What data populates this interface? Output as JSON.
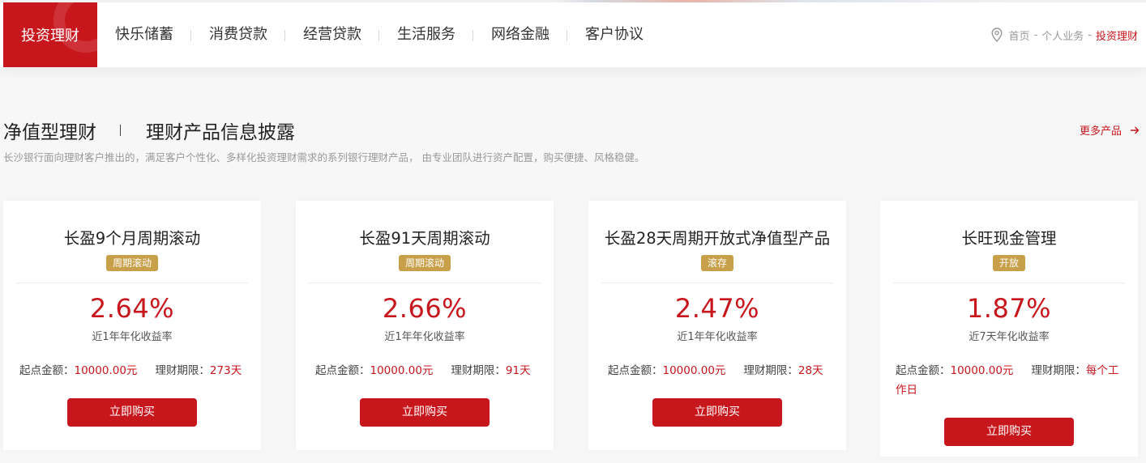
{
  "nav": {
    "active": "投资理财",
    "items": [
      "快乐储蓄",
      "消费贷款",
      "经营贷款",
      "生活服务",
      "网络金融",
      "客户协议"
    ]
  },
  "breadcrumb": {
    "home": "首页",
    "sep": "-",
    "level2": "个人业务",
    "current": "投资理财"
  },
  "section": {
    "title1": "净值型理财",
    "title2": "理财产品信息披露",
    "subtitle": "长沙银行面向理财客户推出的，满足客户个性化、多样化投资理财需求的系列银行理财产品， 由专业团队进行资产配置，购买便捷、风格稳健。",
    "more": "更多产品"
  },
  "products": [
    {
      "name": "长盈9个月周期滚动",
      "tag": "周期滚动",
      "rate": "2.64%",
      "rate_label": "近1年年化收益率",
      "min_label": "起点金额：",
      "min_value": "10000.00元",
      "term_label": "理财期限：",
      "term_value": "273天",
      "button": "立即购买"
    },
    {
      "name": "长盈91天周期滚动",
      "tag": "周期滚动",
      "rate": "2.66%",
      "rate_label": "近1年年化收益率",
      "min_label": "起点金额：",
      "min_value": "10000.00元",
      "term_label": "理财期限：",
      "term_value": "91天",
      "button": "立即购买"
    },
    {
      "name": "长盈28天周期开放式净值型产品",
      "tag": "滚存",
      "rate": "2.47%",
      "rate_label": "近1年年化收益率",
      "min_label": "起点金额：",
      "min_value": "10000.00元",
      "term_label": "理财期限：",
      "term_value": "28天",
      "button": "立即购买"
    },
    {
      "name": "长旺现金管理",
      "tag": "开放",
      "rate": "1.87%",
      "rate_label": "近7天年化收益率",
      "min_label": "起点金额：",
      "min_value": "10000.00元",
      "term_label": "理财期限：",
      "term_value": "每个工作日",
      "button": "立即购买"
    }
  ],
  "colors": {
    "brand_red": "#c8161d",
    "tag_gold": "#c9a04a"
  }
}
